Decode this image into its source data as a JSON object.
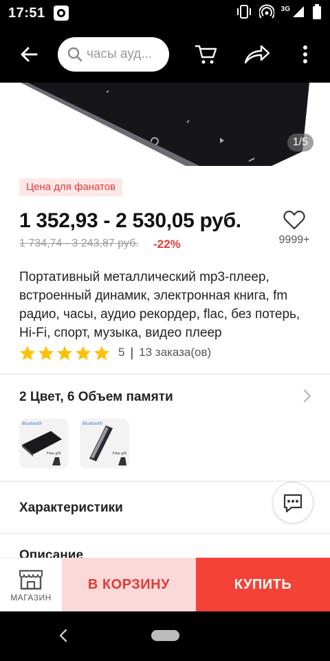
{
  "status_bar": {
    "time": "17:51",
    "network_label": "3G",
    "icons": [
      "media-icon",
      "vibrate-icon",
      "hotspot-icon",
      "signal-icon",
      "battery-icon"
    ]
  },
  "app_bar": {
    "search_placeholder": "часы ауд...",
    "icons": [
      "back-arrow-icon",
      "search-icon",
      "cart-icon",
      "share-icon",
      "more-vert-icon"
    ]
  },
  "gallery": {
    "counter": "1/5"
  },
  "product": {
    "promo_tag": "Цена для фанатов",
    "price": "1 352,93 - 2 530,05 руб.",
    "old_price": "1 734,74 - 3 243,87 руб.",
    "discount": "-22%",
    "wishlist_count": "9999+",
    "title": "Портативный металлический mp3-плеер, встроенный динамик, электронная книга, fm радио, часы, аудио рекордер, flac, без потерь, Hi-Fi, спорт, музыка, видео плеер",
    "rating": {
      "stars": 5,
      "value": "5",
      "separator": "|",
      "orders": "13 заказа(ов)"
    }
  },
  "variants": {
    "title": "2 Цвет, 6 Объем памяти",
    "thumbnails": [
      {
        "label": "Bluetooth",
        "badge": "Free gift"
      },
      {
        "label": "Bluetooth",
        "badge": "Free gift"
      }
    ]
  },
  "sections": {
    "specs_label": "Характеристики",
    "description_label": "Описание"
  },
  "bottom_bar": {
    "store_label": "МАГАЗИН",
    "cart_label": "В КОРЗИНУ",
    "buy_label": "КУПИТЬ"
  },
  "colors": {
    "accent_red": "#f44336",
    "promo_red": "#e53935",
    "cart_bg": "#fcd9d9",
    "star_yellow": "#ffc107"
  }
}
